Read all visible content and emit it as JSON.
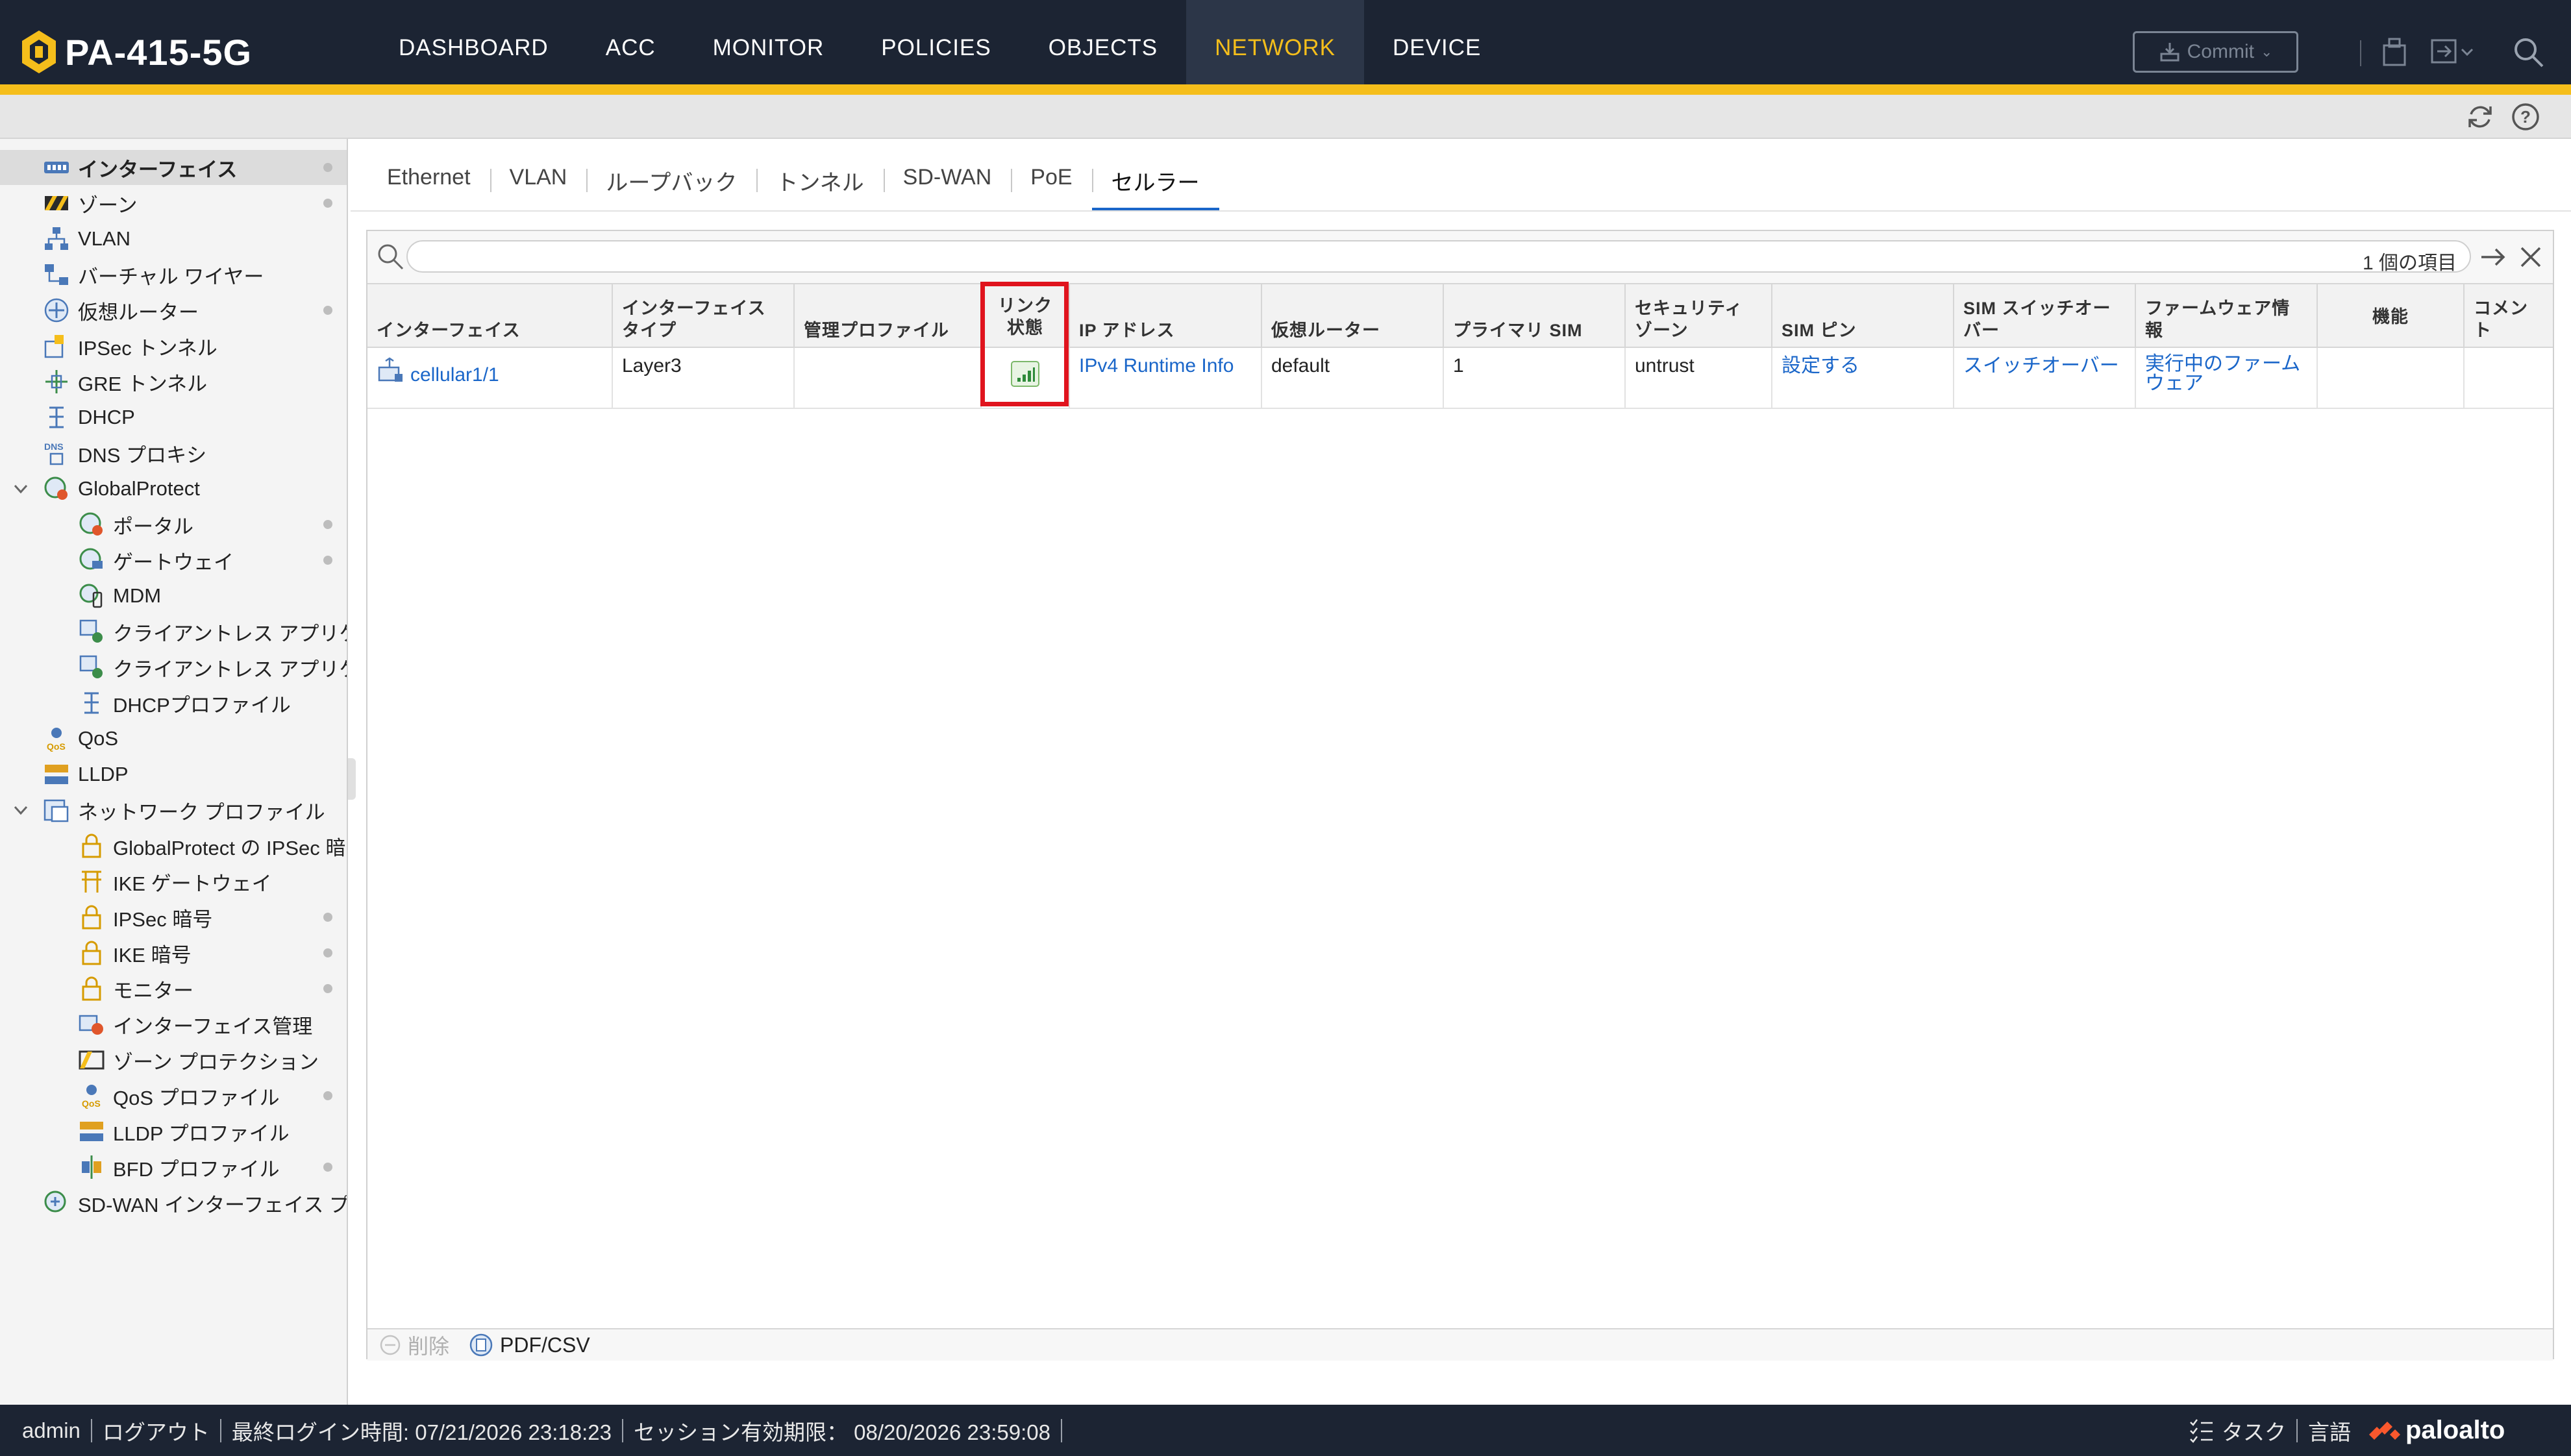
{
  "app": {
    "device_name": "PA-415-5G"
  },
  "nav": {
    "items": [
      "DASHBOARD",
      "ACC",
      "MONITOR",
      "POLICIES",
      "OBJECTS",
      "NETWORK",
      "DEVICE"
    ],
    "active": "NETWORK",
    "commit_label": "Commit"
  },
  "colors": {
    "nav_bg": "#1c2433",
    "accent": "#f5be1b",
    "link": "#1a66c9",
    "highlight": "#e0141e"
  },
  "sidebar": {
    "items": [
      {
        "label": "インターフェイス",
        "icon": "interface-icon",
        "selected": true
      },
      {
        "label": "ゾーン",
        "icon": "zone-icon"
      },
      {
        "label": "VLAN",
        "icon": "vlan-icon"
      },
      {
        "label": "バーチャル ワイヤー",
        "icon": "virtual-wire-icon"
      },
      {
        "label": "仮想ルーター",
        "icon": "router-icon"
      },
      {
        "label": "IPSec トンネル",
        "icon": "ipsec-tunnel-icon"
      },
      {
        "label": "GRE トンネル",
        "icon": "gre-tunnel-icon"
      },
      {
        "label": "DHCP",
        "icon": "dhcp-icon"
      },
      {
        "label": "DNS プロキシ",
        "icon": "dns-proxy-icon"
      },
      {
        "label": "GlobalProtect",
        "icon": "globalprotect-icon"
      },
      {
        "label": "ポータル",
        "icon": "portal-icon"
      },
      {
        "label": "ゲートウェイ",
        "icon": "gateway-icon"
      },
      {
        "label": "MDM",
        "icon": "mdm-icon"
      },
      {
        "label": "クライアントレス アプリケーション",
        "icon": "clientless-app-icon"
      },
      {
        "label": "クライアントレス アプリケーション グループ",
        "icon": "clientless-app-group-icon"
      },
      {
        "label": "DHCPプロファイル",
        "icon": "dhcp-profile-icon"
      },
      {
        "label": "QoS",
        "icon": "qos-icon"
      },
      {
        "label": "LLDP",
        "icon": "lldp-icon"
      },
      {
        "label": "ネットワーク プロファイル",
        "icon": "network-profile-icon"
      },
      {
        "label": "GlobalProtect の IPSec 暗号",
        "icon": "lock-icon"
      },
      {
        "label": "IKE ゲートウェイ",
        "icon": "ike-gateway-icon"
      },
      {
        "label": "IPSec 暗号",
        "icon": "lock-icon"
      },
      {
        "label": "IKE 暗号",
        "icon": "lock-icon"
      },
      {
        "label": "モニター",
        "icon": "monitor-icon"
      },
      {
        "label": "インターフェイス管理",
        "icon": "interface-mgmt-icon"
      },
      {
        "label": "ゾーン プロテクション",
        "icon": "zone-protection-icon"
      },
      {
        "label": "QoS プロファイル",
        "icon": "qos-profile-icon"
      },
      {
        "label": "LLDP プロファイル",
        "icon": "lldp-profile-icon"
      },
      {
        "label": "BFD プロファイル",
        "icon": "bfd-profile-icon"
      },
      {
        "label": "SD-WAN インターフェイス プロファイル",
        "icon": "sdwan-profile-icon"
      }
    ]
  },
  "tabs": {
    "items": [
      "Ethernet",
      "VLAN",
      "ループバック",
      "トンネル",
      "SD-WAN",
      "PoE",
      "セルラー"
    ],
    "active": "セルラー"
  },
  "search": {
    "placeholder": "",
    "count": "1 個の項目"
  },
  "table": {
    "columns": [
      "インターフェイス",
      "インターフェイス タイプ",
      "管理プロファイル",
      "リンク状態",
      "IP アドレス",
      "仮想ルーター",
      "プライマリ SIM",
      "セキュリティ ゾーン",
      "SIM ピン",
      "SIM スイッチオーバー",
      "ファームウェア情報",
      "機能",
      "コメント"
    ],
    "rows": [
      {
        "interface": "cellular1/1",
        "type": "Layer3",
        "mgmt_profile": "",
        "link_state": "signal-bars-icon",
        "ip": "IPv4 Runtime Info",
        "router": "default",
        "primary_sim": "1",
        "zone": "untrust",
        "sim_pin": "設定する",
        "sim_switchover": "スイッチオーバー",
        "firmware": "実行中のファームウェア",
        "features": "",
        "comment": ""
      }
    ]
  },
  "actions": {
    "delete": "削除",
    "pdf_csv": "PDF/CSV"
  },
  "footer": {
    "user": "admin",
    "logout": "ログアウト",
    "last_login": "最終ログイン時間: 07/21/2026 23:18:23",
    "session_expiry": "セッション有効期限： 08/20/2026 23:59:08",
    "tasks": "タスク",
    "language": "言語",
    "brand": "paloalto"
  }
}
